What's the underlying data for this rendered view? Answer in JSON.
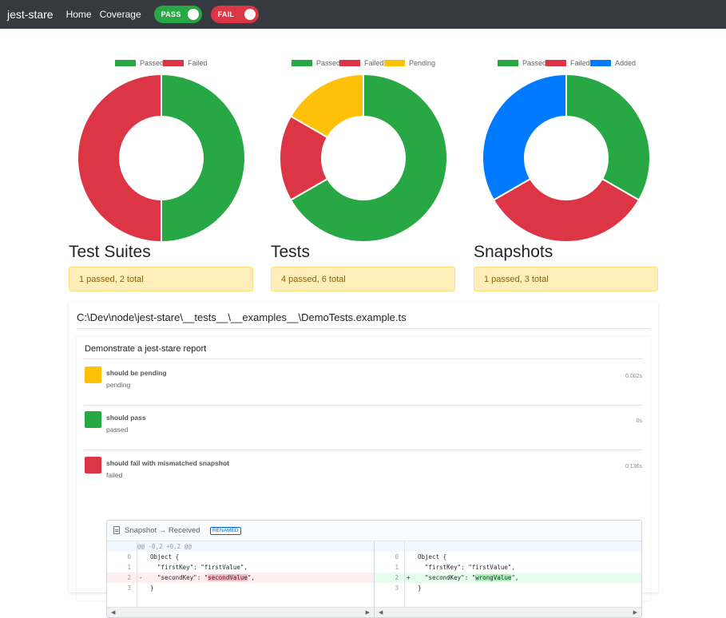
{
  "navbar": {
    "brand": "jest-stare",
    "links": [
      "Home",
      "Coverage"
    ],
    "pass_toggle": "PASS",
    "fail_toggle": "FAIL"
  },
  "colors": {
    "passed": "#28a745",
    "failed": "#dc3545",
    "pending": "#ffc107",
    "added": "#007bff"
  },
  "chart_data": [
    {
      "type": "pie",
      "variant": "doughnut",
      "title": "Test Suites",
      "legend_placement": "top",
      "series": [
        {
          "name": "Passed",
          "value": 1
        },
        {
          "name": "Failed",
          "value": 1
        }
      ]
    },
    {
      "type": "pie",
      "variant": "doughnut",
      "title": "Tests",
      "legend_placement": "top",
      "series": [
        {
          "name": "Passed",
          "value": 4
        },
        {
          "name": "Failed",
          "value": 1
        },
        {
          "name": "Pending",
          "value": 1
        }
      ]
    },
    {
      "type": "pie",
      "variant": "doughnut",
      "title": "Snapshots",
      "legend_placement": "top",
      "series": [
        {
          "name": "Passed",
          "value": 1
        },
        {
          "name": "Failed",
          "value": 1
        },
        {
          "name": "Added",
          "value": 1
        }
      ]
    }
  ],
  "stats": [
    {
      "title": "Test Suites",
      "summary": "1 passed, 2 total"
    },
    {
      "title": "Tests",
      "summary": "4 passed, 6 total"
    },
    {
      "title": "Snapshots",
      "summary": "1 passed, 3 total"
    }
  ],
  "file": {
    "path": "C:\\Dev\\node\\jest-stare\\__tests__\\__examples__\\DemoTests.example.ts",
    "describe": "Demonstrate a jest-stare report",
    "tests": [
      {
        "title": "should be pending",
        "status": "pending",
        "duration": "0.002s",
        "color": "#ffc107"
      },
      {
        "title": "should pass",
        "status": "passed",
        "duration": "0s",
        "color": "#28a745"
      },
      {
        "title": "should fail with mismatched snapshot",
        "status": "failed",
        "duration": "0.136s",
        "color": "#dc3545"
      }
    ]
  },
  "diff": {
    "header": "Snapshot → Received",
    "badge": "RENAMED",
    "hunk": "@@ -0,2 +0,2 @@",
    "left": {
      "numbers": [
        "0",
        "1",
        "2",
        "3"
      ],
      "lines": [
        "Object {",
        "  \"firstKey\": \"firstValue\",",
        "  \"secondKey\": \"",
        "}"
      ],
      "changed_value": "secondValue",
      "changed_suffix": "\",",
      "sign": "-"
    },
    "right": {
      "numbers": [
        "0",
        "1",
        "2",
        "3"
      ],
      "lines": [
        "Object {",
        "  \"firstKey\": \"firstValue\",",
        "  \"secondKey\": \"",
        "}"
      ],
      "changed_value": "wrongValue",
      "changed_suffix": "\",",
      "sign": "+"
    }
  }
}
